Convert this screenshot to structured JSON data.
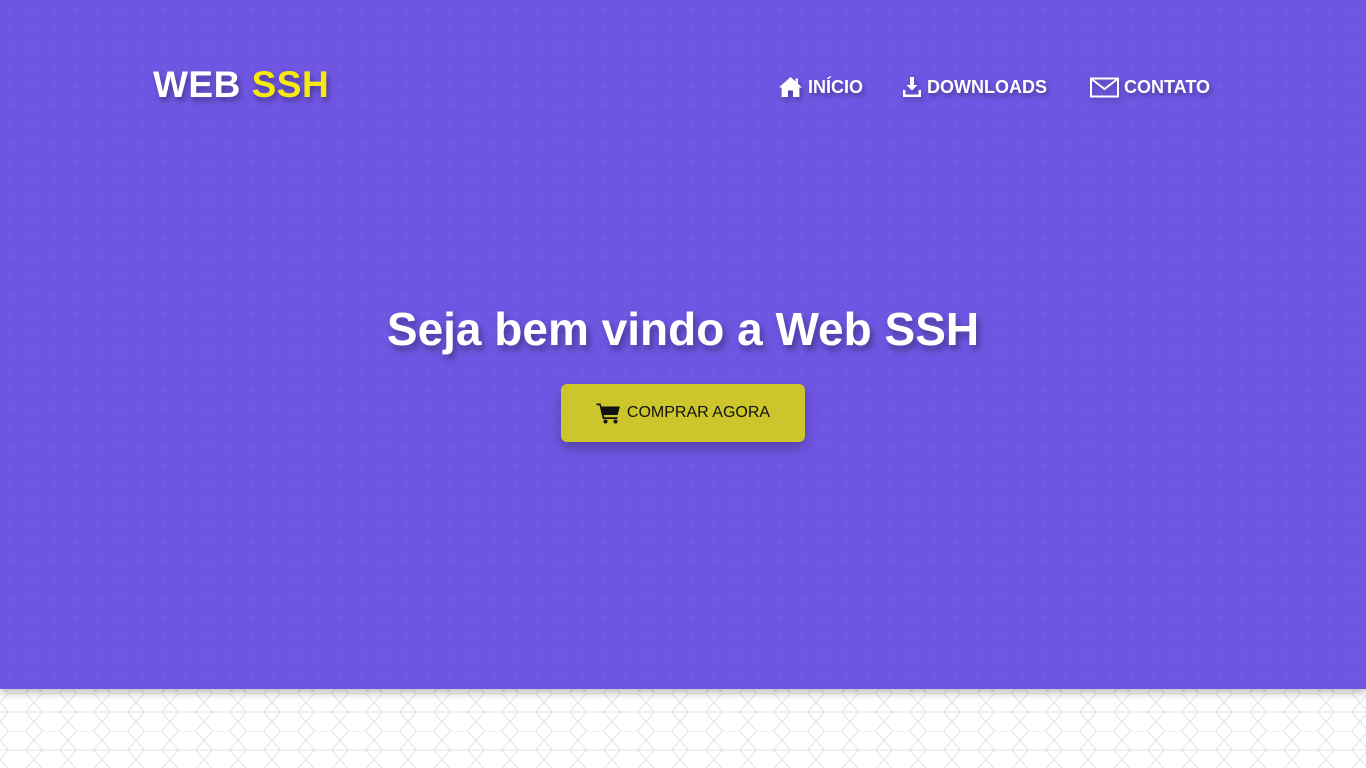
{
  "brand": {
    "part1": "WEB",
    "part2": "SSH",
    "accent_color": "#f6ea0c"
  },
  "nav": {
    "items": [
      {
        "label": "INÍCIO",
        "icon": "home-icon"
      },
      {
        "label": "DOWNLOADS",
        "icon": "download-icon"
      },
      {
        "label": "CONTATO",
        "icon": "envelope-icon"
      }
    ]
  },
  "hero": {
    "headline": "Seja bem vindo a Web SSH",
    "cta_label": "COMPRAR AGORA",
    "cta_icon": "cart-icon",
    "background_color": "#6f56e2",
    "cta_color": "#cdc52c"
  }
}
